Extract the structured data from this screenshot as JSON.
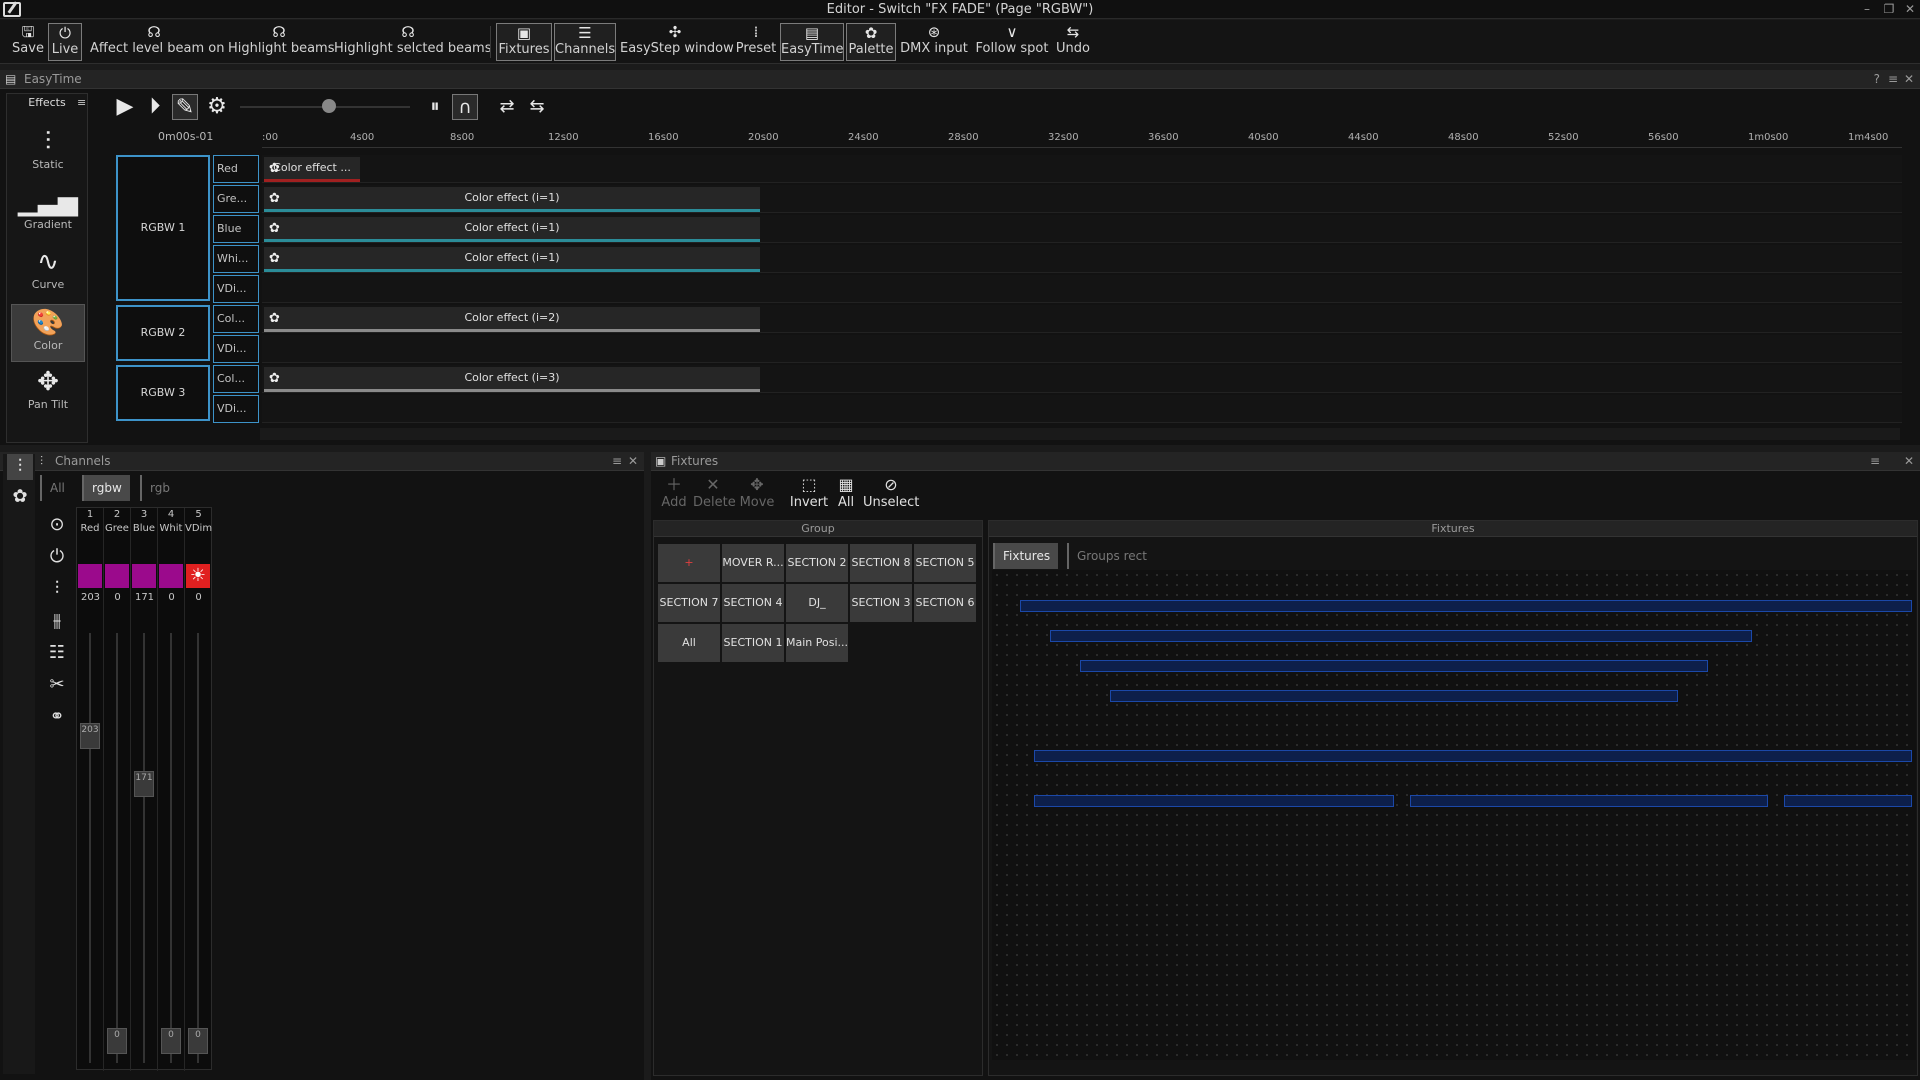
{
  "window": {
    "title": "Editor - Switch \"FX FADE\" (Page \"RGBW\")"
  },
  "toolbar": {
    "save": "Save",
    "live": "Live",
    "affect": "Affect level beam on",
    "highlight_beams": "Highlight beams",
    "highlight_selected": "Highlight selcted beams",
    "fixtures": "Fixtures",
    "channels": "Channels",
    "easystep": "EasyStep window",
    "preset": "Preset",
    "easytime": "EasyTime",
    "palette": "Palette",
    "dmx_input": "DMX input",
    "follow_spot": "Follow spot",
    "undo": "Undo"
  },
  "easytime": {
    "title": "EasyTime",
    "effects_label": "Effects",
    "current_time": "0m00s-01",
    "effects": [
      "Static",
      "Gradient",
      "Curve",
      "Color",
      "Pan Tilt"
    ],
    "ruler": [
      ":00",
      "4s00",
      "8s00",
      "12s00",
      "16s00",
      "20s00",
      "24s00",
      "28s00",
      "32s00",
      "36s00",
      "40s00",
      "44s00",
      "48s00",
      "52s00",
      "56s00",
      "1m0s00",
      "1m4s00"
    ],
    "groups": [
      "RGBW 1",
      "RGBW 2",
      "RGBW 3"
    ],
    "channels": [
      "Red",
      "Gre...",
      "Blue",
      "Whi...",
      "VDi...",
      "Col...",
      "VDi...",
      "Col...",
      "VDi..."
    ],
    "clips": [
      "Color effect ...",
      "Color effect (i=1)",
      "Color effect (i=1)",
      "Color effect (i=1)",
      "Color effect (i=2)",
      "Color effect (i=3)"
    ]
  },
  "channels": {
    "title": "Channels",
    "tabs": [
      "All",
      "rgbw",
      "rgb"
    ],
    "cols": [
      {
        "n": "1",
        "name": "Red",
        "val": "203",
        "color": "#9b0a8c"
      },
      {
        "n": "2",
        "name": "Gree",
        "val": "0",
        "color": "#9b0a8c"
      },
      {
        "n": "3",
        "name": "Blue",
        "val": "171",
        "color": "#9b0a8c"
      },
      {
        "n": "4",
        "name": "Whit",
        "val": "0",
        "color": "#9b0a8c"
      },
      {
        "n": "5",
        "name": "VDim",
        "val": "0",
        "color": "#e02020"
      }
    ],
    "fader_values": [
      "203",
      "0",
      "171",
      "0",
      "0"
    ]
  },
  "fixtures": {
    "title": "Fixtures",
    "tools": [
      "Add",
      "Delete",
      "Move",
      "Invert",
      "All",
      "Unselect"
    ],
    "group_header": "Group",
    "fixtures_header": "Fixtures",
    "groups": [
      "+",
      "MOVER R...",
      "SECTION 2",
      "SECTION 8",
      "SECTION 5",
      "SECTION 7",
      "SECTION 4",
      "DJ_",
      "SECTION 3",
      "SECTION 6",
      "All",
      "SECTION 1",
      "Main Posi..."
    ],
    "tabs": [
      "Fixtures",
      "Groups rect"
    ]
  },
  "colors": {
    "accent": "#3d93c9",
    "teal": "#2b8c98",
    "magenta": "#9b0a8c"
  }
}
